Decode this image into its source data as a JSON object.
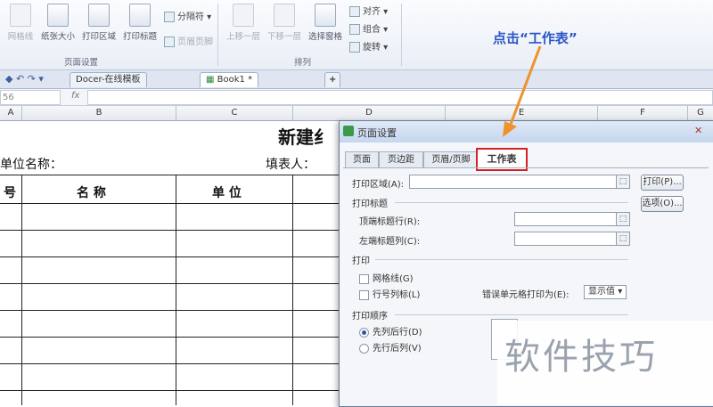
{
  "ribbon": {
    "buttons": [
      {
        "label": "网格线",
        "disabled": true
      },
      {
        "label": "纸张大小",
        "disabled": false
      },
      {
        "label": "打印区域",
        "disabled": false
      },
      {
        "label": "打印标题",
        "disabled": false
      }
    ],
    "small_items": [
      "分隔符",
      "页眉页脚"
    ],
    "arrange_buttons": [
      "上移一层",
      "下移一层",
      "选择窗格"
    ],
    "align_items": [
      "对齐",
      "组合",
      "旋转"
    ],
    "groups": [
      "页面设置",
      "排列"
    ]
  },
  "tabs": {
    "docer": "Docer-在线模板",
    "book": "Book1 *",
    "add": "+"
  },
  "formula_bar": {
    "cell_ref": "56",
    "fx": "fx"
  },
  "columns": [
    "A",
    "B",
    "C",
    "D",
    "E",
    "F",
    "G"
  ],
  "sheet": {
    "title": "新建纟",
    "unit_label": "单位名称：",
    "filler_label": "填表人：",
    "col_no": "号",
    "col_name": "名 称",
    "col_unit": "单 位"
  },
  "dialog": {
    "title": "页面设置",
    "tabs": [
      "页面",
      "页边距",
      "页眉/页脚",
      "工作表"
    ],
    "print_area_label": "打印区域(A):",
    "print_btn": "打印(P)...",
    "options_btn": "选项(O)...",
    "print_titles_label": "打印标题",
    "top_rows_label": "顶端标题行(R):",
    "left_cols_label": "左端标题列(C):",
    "print_group_label": "打印",
    "gridlines_label": "网格线(G)",
    "rowcol_label": "行号列标(L)",
    "errors_label": "错误单元格打印为(E):",
    "errors_value": "显示值",
    "order_label": "打印顺序",
    "order_down": "先列后行(D)",
    "order_over": "先行后列(V)"
  },
  "annotation": "点击“工作表”",
  "watermark": "软件技巧",
  "colors": {
    "highlight": "#d42222",
    "arrow": "#f0922a",
    "annotation": "#2a56c6"
  }
}
